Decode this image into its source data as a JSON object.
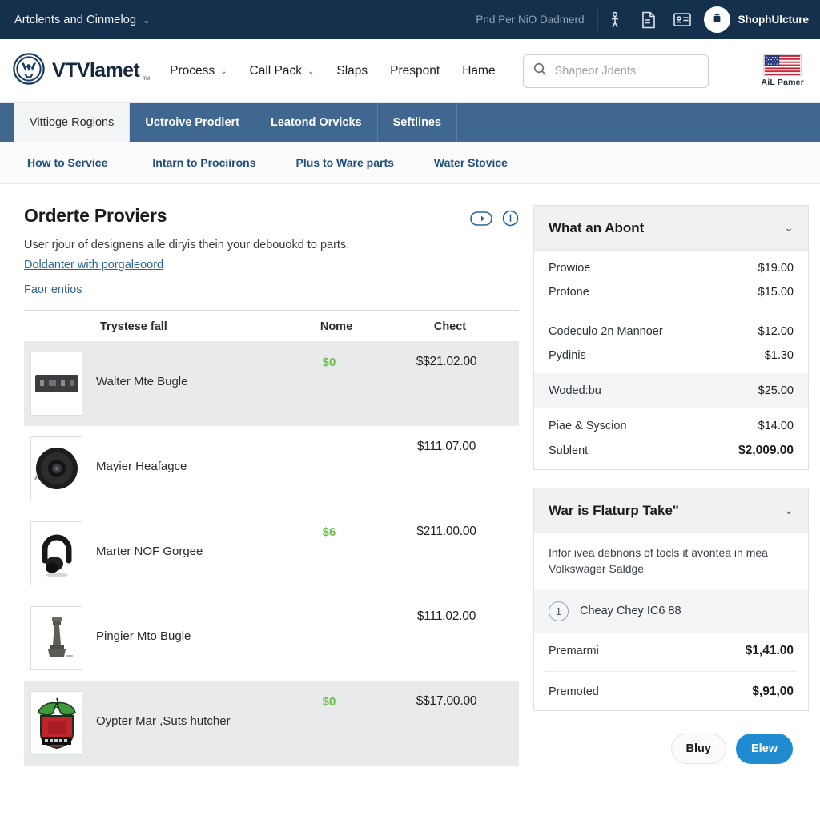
{
  "utility_bar": {
    "account_menu": "Artclents and Cinmelog",
    "caret": "⌄",
    "message": "Pnd Per NiO Dadmerd",
    "icons": [
      "person-pin-icon",
      "document-icon",
      "id-card-icon"
    ],
    "avatar_icon": "user-avatar-icon",
    "shop_name": "ShophUlcture"
  },
  "header": {
    "brand": "VTVlamet",
    "brand_tm": "TM",
    "logo_icon": "volkswagen-logo-icon",
    "nav": [
      {
        "label": "Process",
        "caret": "⌄"
      },
      {
        "label": "Call Pack",
        "caret": "⌄"
      },
      {
        "label": "Slaps",
        "caret": ""
      },
      {
        "label": "Prespont",
        "caret": ""
      },
      {
        "label": "Hame",
        "caret": ""
      }
    ],
    "search": {
      "placeholder": "Shapeor Jdents",
      "value": "",
      "icon": "search-icon"
    },
    "locale": {
      "flag_icon": "us-flag-icon",
      "label": "AiL Pamer"
    }
  },
  "tabs": [
    {
      "label": "Vittioge Rogions",
      "active": true
    },
    {
      "label": "Uctroive Prodiert",
      "active": false
    },
    {
      "label": "Leatond Orvicks",
      "active": false
    },
    {
      "label": "Seftlines",
      "active": false
    }
  ],
  "subnav": [
    "How to Service",
    "Intarn to Prociirons",
    "Plus to Ware parts",
    "Water Stovice"
  ],
  "main": {
    "title": "Orderte Proviers",
    "description": "User rjour of designens alle diryis thein your debouokd to parts.",
    "link": "Doldanter with porgaleoord",
    "subtext": "Faor entios",
    "actions": [
      {
        "name": "play-pill-icon"
      },
      {
        "name": "info-circle-icon"
      }
    ],
    "table": {
      "columns": [
        "Trystese fall",
        "Nome",
        "Chect"
      ],
      "rows": [
        {
          "name": "Walter Mte Bugle",
          "qty": "$0",
          "price": "$$21.02.00",
          "shaded": true,
          "thumb": "module-thumb"
        },
        {
          "name": "Mayier Heafagce",
          "qty": "",
          "price": "$111.07.00",
          "shaded": false,
          "thumb": "speaker-thumb"
        },
        {
          "name": "Marter NOF Gorgee",
          "qty": "$6",
          "price": "$211.00.00",
          "shaded": false,
          "thumb": "headphone-thumb"
        },
        {
          "name": "Pingier Mto Bugle",
          "qty": "",
          "price": "$111.02.00",
          "shaded": false,
          "thumb": "nozzle-thumb"
        },
        {
          "name": "Oypter Mar ,Suts hutcher",
          "qty": "$0",
          "price": "$$17.00.00",
          "shaded": true,
          "thumb": "apple-crest-thumb"
        }
      ]
    }
  },
  "panels": [
    {
      "title": "What an Abont",
      "caret": "⌄",
      "lines": [
        {
          "label": "Prowioe",
          "value": "$19.00",
          "tinted": false,
          "bold": false
        },
        {
          "label": "Protone",
          "value": "$15.00",
          "tinted": false,
          "bold": false
        },
        {
          "label": "Codeculo 2n Mannoer",
          "value": "$12.00",
          "tinted": false,
          "bold": false
        },
        {
          "label": "Pydinis",
          "value": "$1.30",
          "tinted": false,
          "bold": false
        },
        {
          "label": "Woded:bu",
          "value": "$25.00",
          "tinted": true,
          "bold": false
        },
        {
          "label": "Piae & Syscion",
          "value": "$14.00",
          "tinted": false,
          "bold": false
        },
        {
          "label": "Sublent",
          "value": "$2,009.00",
          "tinted": false,
          "bold": true
        }
      ]
    },
    {
      "title": "War is Flaturp Take\"",
      "caret": "⌄",
      "note": "Infor ivea debnons of tocls it avontea in mea Volkswager Saldge",
      "step": {
        "number": "1",
        "label": "Cheay Chey IC6 88"
      },
      "lines": [
        {
          "label": "Premarmi",
          "value": "$1,41.00",
          "bold": true
        },
        {
          "label": "Premoted",
          "value": "$,91,00",
          "bold": true
        }
      ]
    }
  ],
  "footer_buttons": [
    {
      "label": "Bluy",
      "style": "secondary"
    },
    {
      "label": "Elew",
      "style": "primary"
    }
  ],
  "colors": {
    "utility_bar": "#14304d",
    "tabstrip": "#3f678f",
    "accent_link": "#205080",
    "qty_green": "#6cc04a",
    "primary_button": "#1f8bd0"
  }
}
